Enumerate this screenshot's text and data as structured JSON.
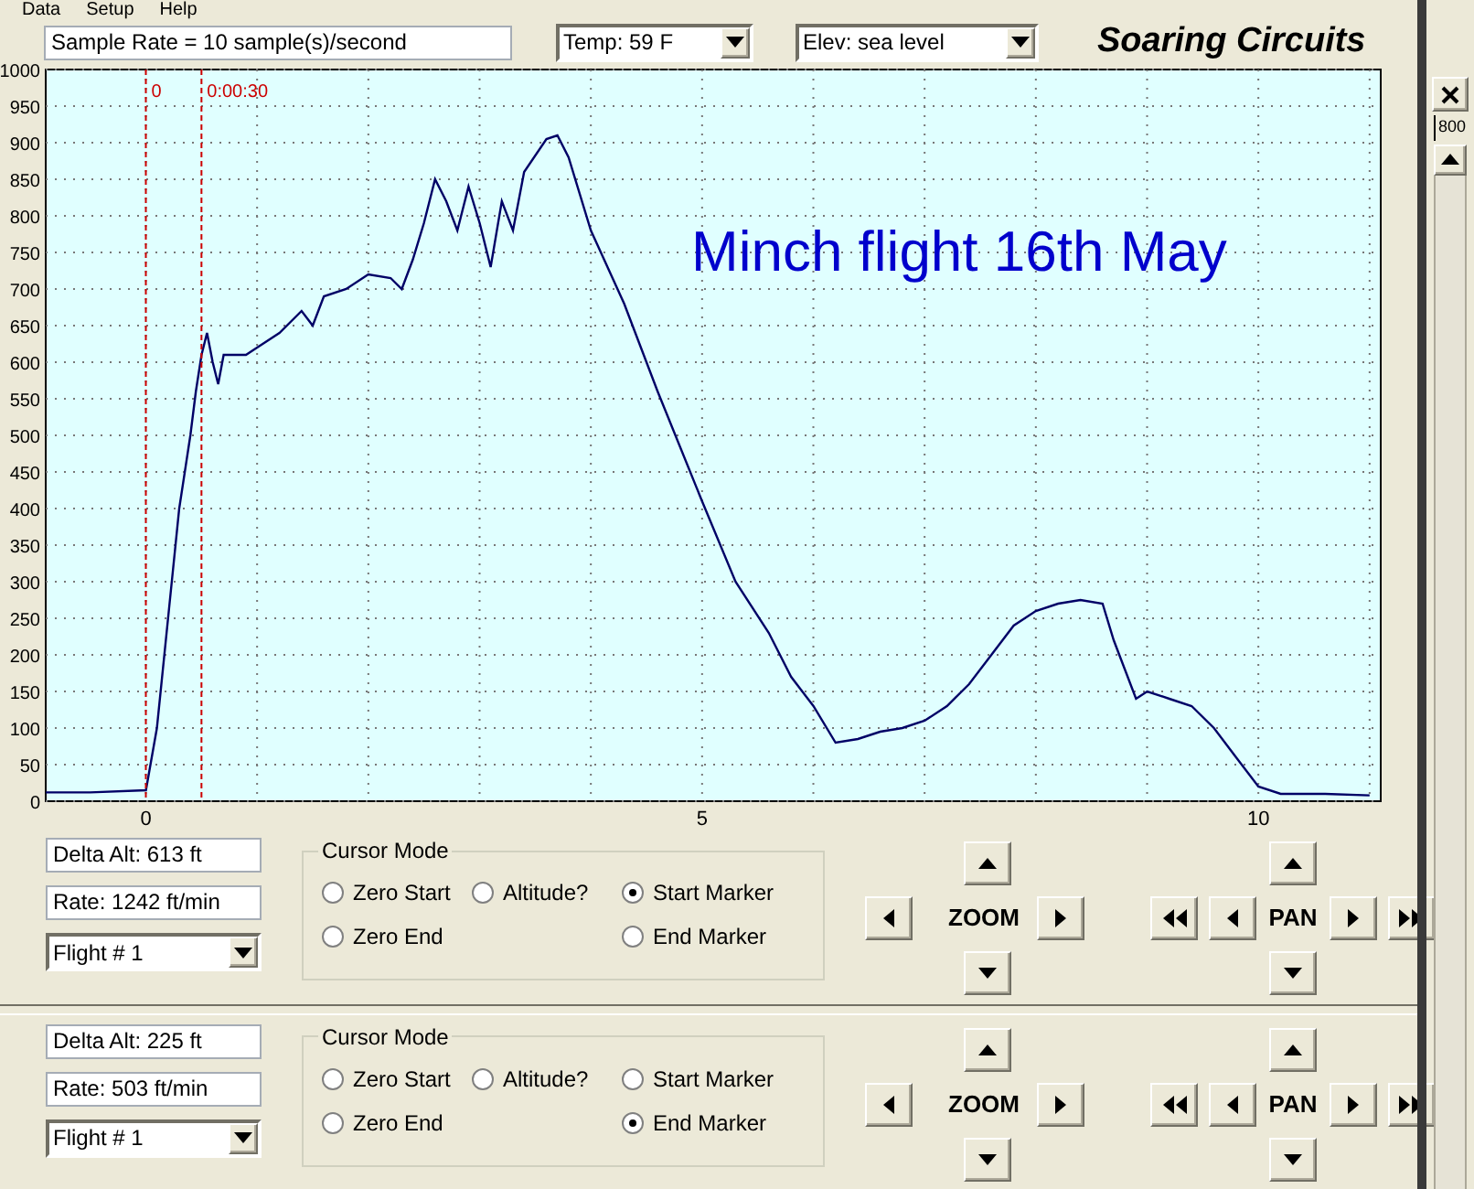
{
  "menu": [
    "Data",
    "Setup",
    "Help"
  ],
  "toolbar": {
    "sample_rate": "Sample Rate =  10 sample(s)/second",
    "temp": "Temp:  59 F",
    "elevation": "Elev: sea level",
    "logo": "Soaring Circuits"
  },
  "chart": {
    "chart_data": {
      "type": "line",
      "title": "Minch flight 16th May",
      "xlim": [
        -0.9,
        11.1
      ],
      "ylim": [
        0,
        1000
      ],
      "xticks": [
        0,
        5,
        10
      ],
      "yticks": [
        0,
        50,
        100,
        150,
        200,
        250,
        300,
        350,
        400,
        450,
        500,
        550,
        600,
        650,
        700,
        750,
        800,
        850,
        900,
        950,
        1000
      ],
      "grid": true,
      "x": [
        -0.9,
        -0.5,
        0,
        0.1,
        0.2,
        0.3,
        0.4,
        0.45,
        0.5,
        0.55,
        0.6,
        0.65,
        0.7,
        0.9,
        1.0,
        1.2,
        1.4,
        1.5,
        1.6,
        1.8,
        2.0,
        2.2,
        2.3,
        2.4,
        2.5,
        2.6,
        2.7,
        2.8,
        2.9,
        3.0,
        3.1,
        3.2,
        3.3,
        3.4,
        3.6,
        3.7,
        3.8,
        4.0,
        4.3,
        4.6,
        5.0,
        5.3,
        5.6,
        5.8,
        6.0,
        6.2,
        6.4,
        6.6,
        6.8,
        7.0,
        7.2,
        7.4,
        7.6,
        7.8,
        8.0,
        8.2,
        8.4,
        8.6,
        8.7,
        8.8,
        8.9,
        9.0,
        9.2,
        9.4,
        9.6,
        9.8,
        10.0,
        10.2,
        10.6,
        11.0
      ],
      "series": [
        {
          "color": "#000066",
          "values": [
            12,
            12,
            15,
            100,
            250,
            400,
            500,
            560,
            610,
            640,
            600,
            570,
            610,
            610,
            620,
            640,
            670,
            650,
            690,
            700,
            720,
            715,
            700,
            740,
            790,
            850,
            820,
            780,
            840,
            790,
            730,
            820,
            780,
            860,
            905,
            910,
            880,
            780,
            680,
            560,
            410,
            300,
            230,
            170,
            130,
            80,
            85,
            95,
            100,
            110,
            130,
            160,
            200,
            240,
            260,
            270,
            275,
            270,
            220,
            180,
            140,
            150,
            140,
            130,
            100,
            60,
            20,
            10,
            10,
            8
          ]
        }
      ],
      "ref_lines": [
        {
          "axis": "x",
          "value": 0,
          "label": "0",
          "color": "#cc0000"
        },
        {
          "axis": "x",
          "value": 0.5,
          "label": "0:00:30",
          "color": "#cc0000"
        }
      ]
    }
  },
  "panels": [
    {
      "delta_alt": "Delta Alt: 613 ft",
      "rate": "Rate: 1242 ft/min",
      "flight": "Flight # 1",
      "cursor_mode": {
        "title": "Cursor Mode",
        "options": [
          {
            "label": "Zero Start",
            "selected": false
          },
          {
            "label": "Altitude?",
            "selected": false
          },
          {
            "label": "Start Marker",
            "selected": true
          },
          {
            "label": "Zero End",
            "selected": false
          },
          {
            "label": "End Marker",
            "selected": false
          }
        ]
      },
      "zoom_label": "ZOOM",
      "pan_label": "PAN"
    },
    {
      "delta_alt": "Delta Alt: 225 ft",
      "rate": "Rate: 503 ft/min",
      "flight": "Flight # 1",
      "cursor_mode": {
        "title": "Cursor Mode",
        "options": [
          {
            "label": "Zero Start",
            "selected": false
          },
          {
            "label": "Altitude?",
            "selected": false
          },
          {
            "label": "Start Marker",
            "selected": false
          },
          {
            "label": "Zero End",
            "selected": false
          },
          {
            "label": "End Marker",
            "selected": true
          }
        ]
      },
      "zoom_label": "ZOOM",
      "pan_label": "PAN"
    }
  ],
  "side_panel": {
    "reading": "800"
  }
}
